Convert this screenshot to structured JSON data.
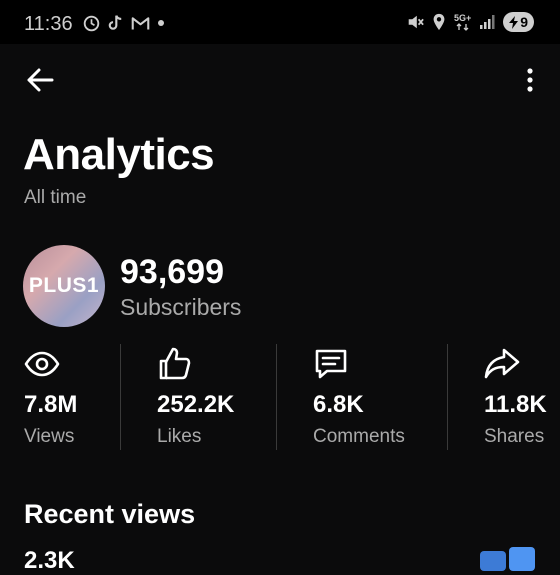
{
  "status_bar": {
    "time": "11:36",
    "network": "5G+",
    "battery": "9"
  },
  "header": {
    "title": "Analytics",
    "period": "All time"
  },
  "channel": {
    "avatar_text": "PLUS1",
    "subscriber_count": "93,699",
    "subscriber_label": "Subscribers"
  },
  "stats": [
    {
      "icon": "eye-icon",
      "value": "7.8M",
      "label": "Views"
    },
    {
      "icon": "thumbs-up-icon",
      "value": "252.2K",
      "label": "Likes"
    },
    {
      "icon": "comment-icon",
      "value": "6.8K",
      "label": "Comments"
    },
    {
      "icon": "share-icon",
      "value": "11.8K",
      "label": "Shares"
    }
  ],
  "recent": {
    "title": "Recent views",
    "value_partial": "2.3K"
  },
  "colors": {
    "background": "#0b0b0c",
    "text": "#ffffff",
    "secondary_text": "#aaaaaa",
    "divider": "#3a3a3a",
    "accent_blue": "#4f95f2"
  }
}
